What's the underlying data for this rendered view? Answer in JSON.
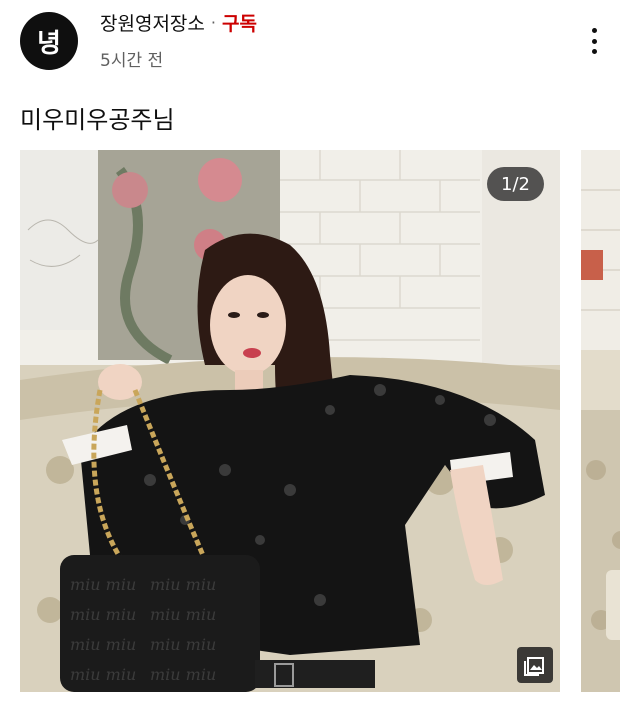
{
  "channel": {
    "avatar_letter": "녕",
    "name": "장원영저장소",
    "separator": "·",
    "subscribe_label": "구독",
    "time_ago": "5시간 전"
  },
  "post": {
    "text": "미우미우공주님",
    "page_counter": "1/2",
    "photo_bag_text": "miu miu"
  },
  "colors": {
    "subscribe": "#cc0000",
    "jacket": "#141414",
    "background_wall": "#f1efe9"
  },
  "icons": {
    "more": "more-vert-icon",
    "gallery": "image-gallery-icon"
  }
}
